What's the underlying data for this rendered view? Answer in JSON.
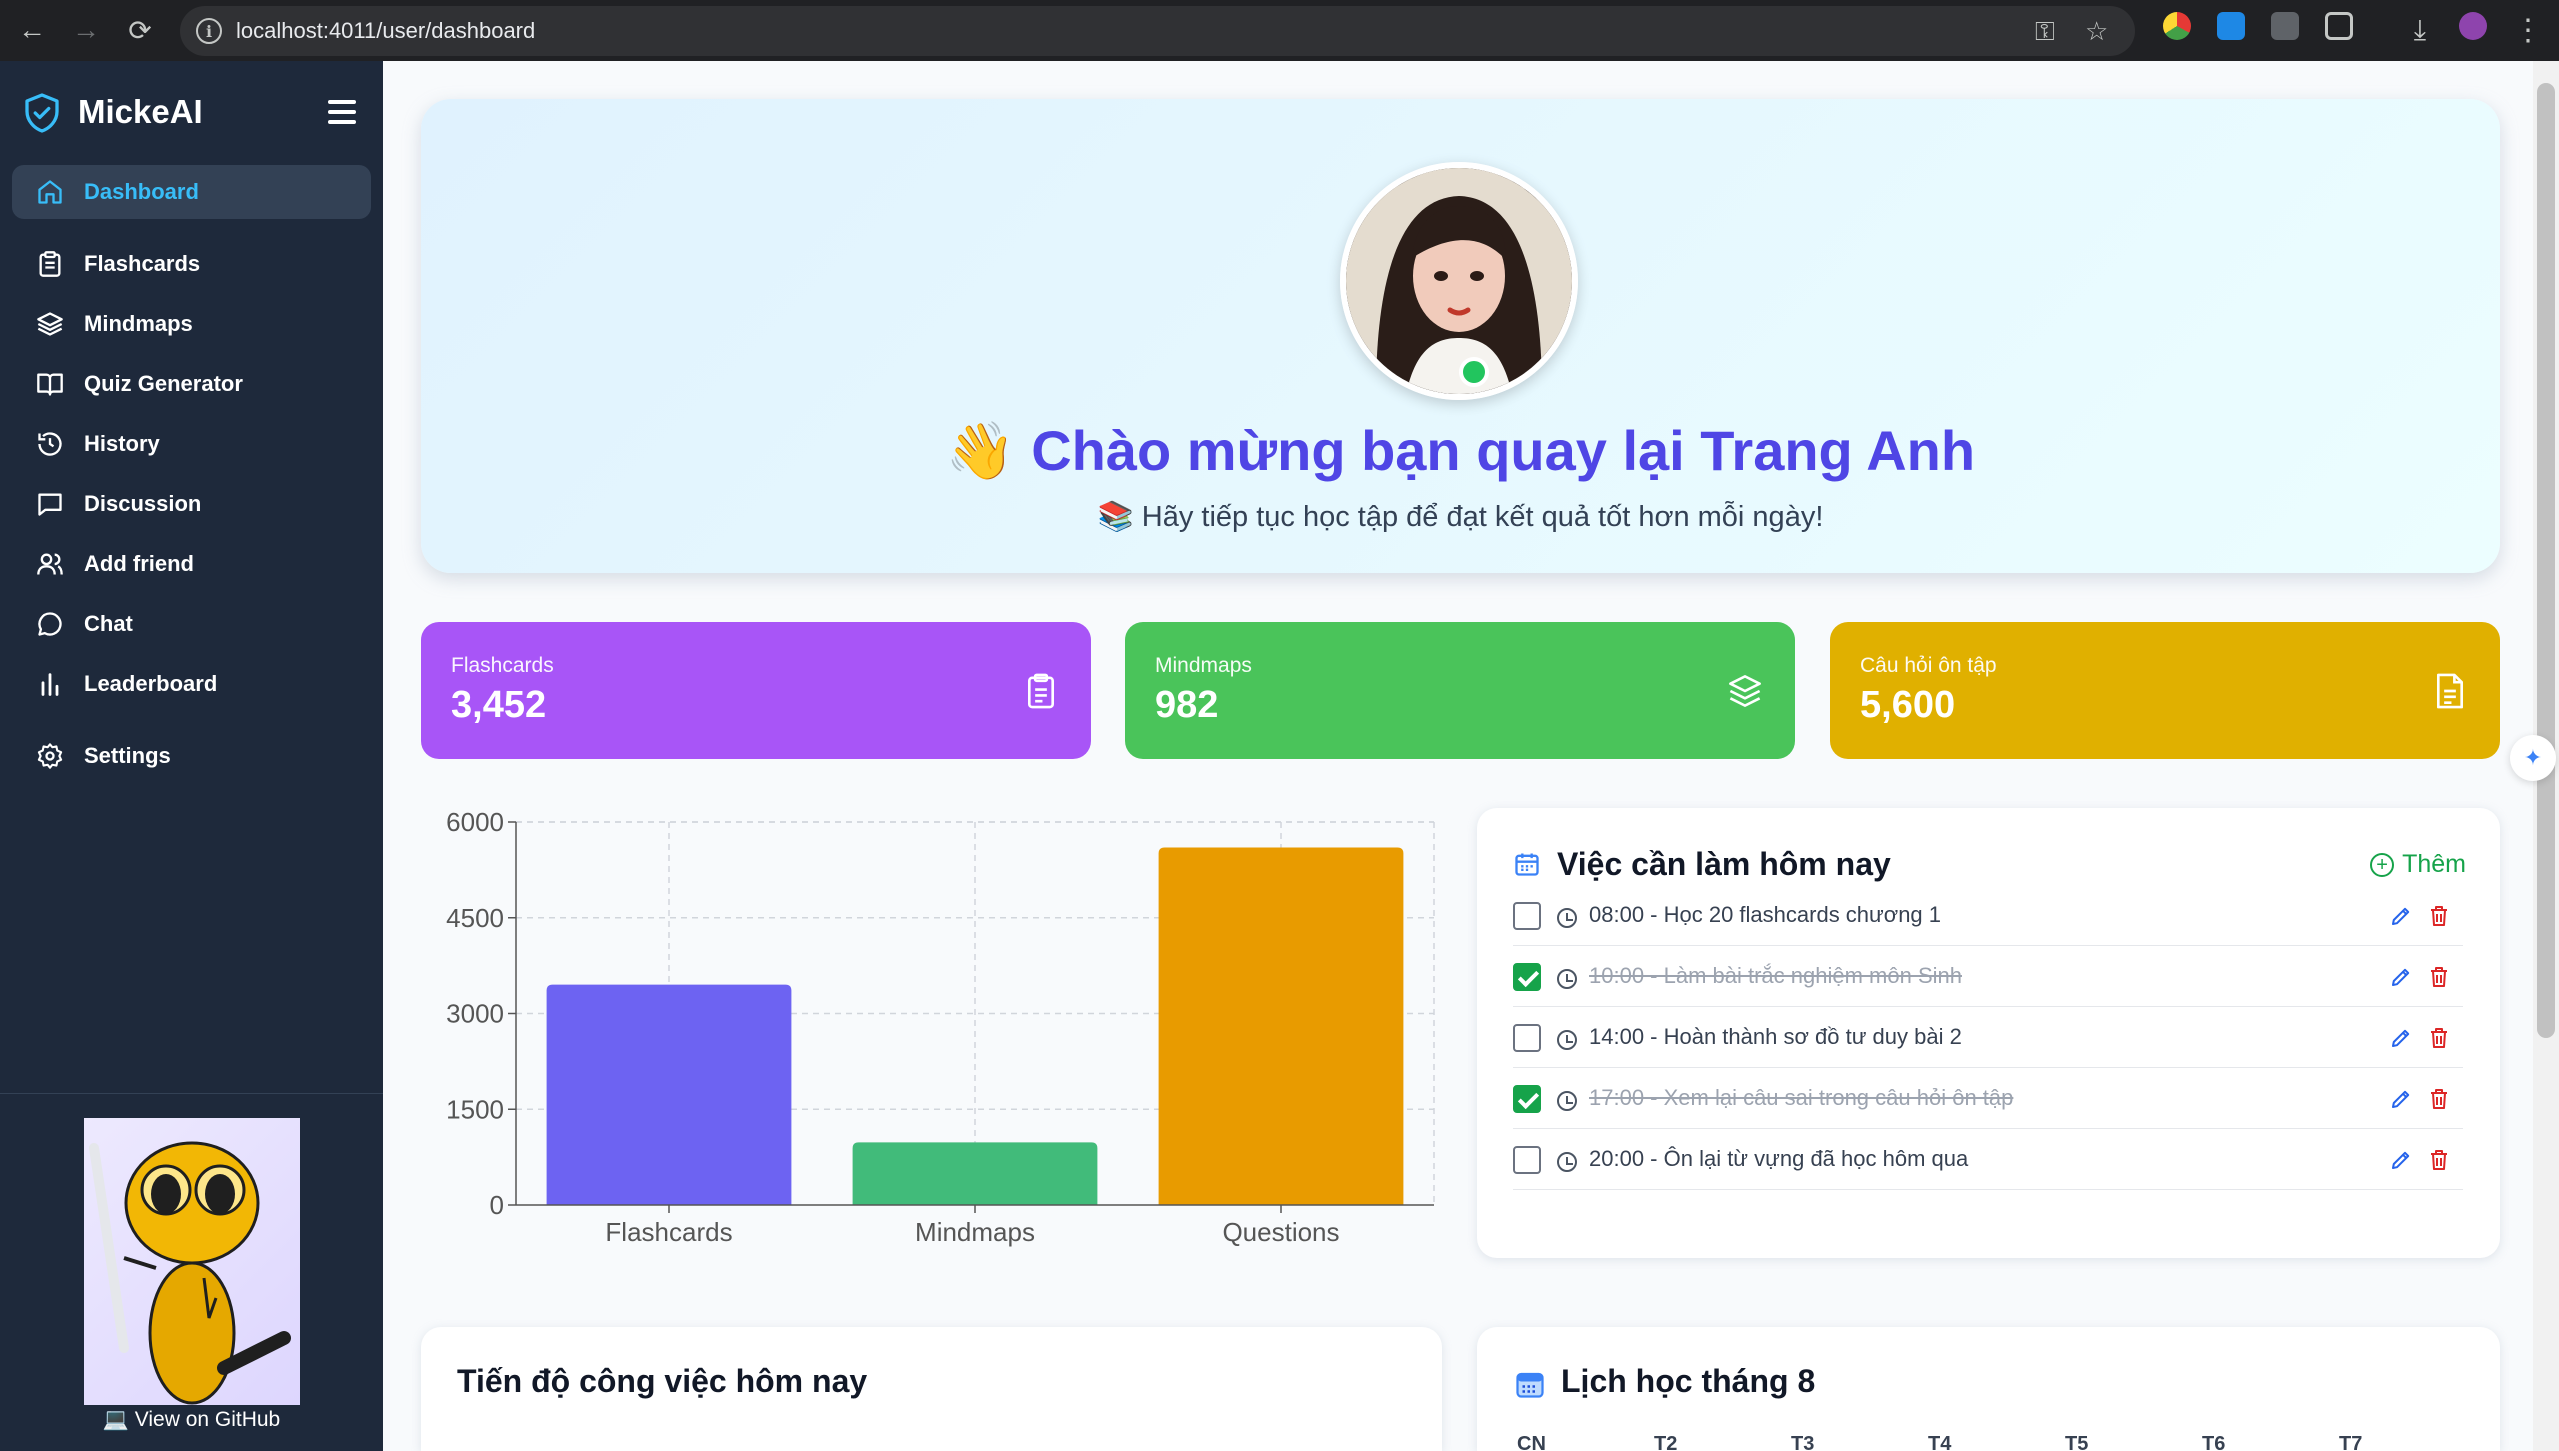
{
  "browser": {
    "url": "localhost:4011/user/dashboard"
  },
  "sidebar": {
    "brand": "MickeAI",
    "items": [
      {
        "label": "Dashboard",
        "icon": "home-icon",
        "active": true
      },
      {
        "label": "Flashcards",
        "icon": "clipboard-icon"
      },
      {
        "label": "Mindmaps",
        "icon": "layers-icon"
      },
      {
        "label": "Quiz Generator",
        "icon": "book-icon"
      },
      {
        "label": "History",
        "icon": "history-icon"
      },
      {
        "label": "Discussion",
        "icon": "message-square-icon"
      },
      {
        "label": "Add friend",
        "icon": "users-icon"
      },
      {
        "label": "Chat",
        "icon": "chat-bubble-icon"
      },
      {
        "label": "Leaderboard",
        "icon": "bar-chart-icon"
      },
      {
        "label": "Settings",
        "icon": "gear-icon"
      }
    ],
    "github_link": "💻 View on GitHub"
  },
  "hero": {
    "wave": "👋",
    "title": "Chào mừng bạn quay lại Trang Anh",
    "subtitle": "📚 Hãy tiếp tục học tập để đạt kết quả tốt hơn mỗi ngày!"
  },
  "stats": [
    {
      "label": "Flashcards",
      "value": "3,452",
      "color": "#a855f7",
      "icon": "clipboard-icon"
    },
    {
      "label": "Mindmaps",
      "value": "982",
      "color": "#4ac45a",
      "icon": "layers-icon"
    },
    {
      "label": "Câu hỏi ôn tập",
      "value": "5,600",
      "color": "#e0b000",
      "icon": "file-text-icon"
    }
  ],
  "chart_data": {
    "type": "bar",
    "categories": [
      "Flashcards",
      "Mindmaps",
      "Questions"
    ],
    "values": [
      3452,
      982,
      5600
    ],
    "colors": [
      "#6d63f2",
      "#41bb7a",
      "#e89b00"
    ],
    "ylim": [
      0,
      6000
    ],
    "yticks": [
      0,
      1500,
      3000,
      4500,
      6000
    ],
    "grid": true,
    "title": "",
    "xlabel": "",
    "ylabel": ""
  },
  "todo": {
    "title": "Việc cần làm hôm nay",
    "add_label": "Thêm",
    "items": [
      {
        "text": "08:00 - Học 20 flashcards chương 1",
        "done": false
      },
      {
        "text": "10:00 - Làm bài trắc nghiệm môn Sinh",
        "done": true
      },
      {
        "text": "14:00 - Hoàn thành sơ đồ tư duy bài 2",
        "done": false
      },
      {
        "text": "17:00 - Xem lại câu sai trong câu hỏi ôn tập",
        "done": true
      },
      {
        "text": "20:00 - Ôn lại từ vựng đã học hôm qua",
        "done": false
      }
    ]
  },
  "progress_card": {
    "title": "Tiến độ công việc hôm nay"
  },
  "calendar_card": {
    "title": "Lịch học tháng 8",
    "weekdays": [
      "CN",
      "T2",
      "T3",
      "T4",
      "T5",
      "T6",
      "T7"
    ]
  }
}
